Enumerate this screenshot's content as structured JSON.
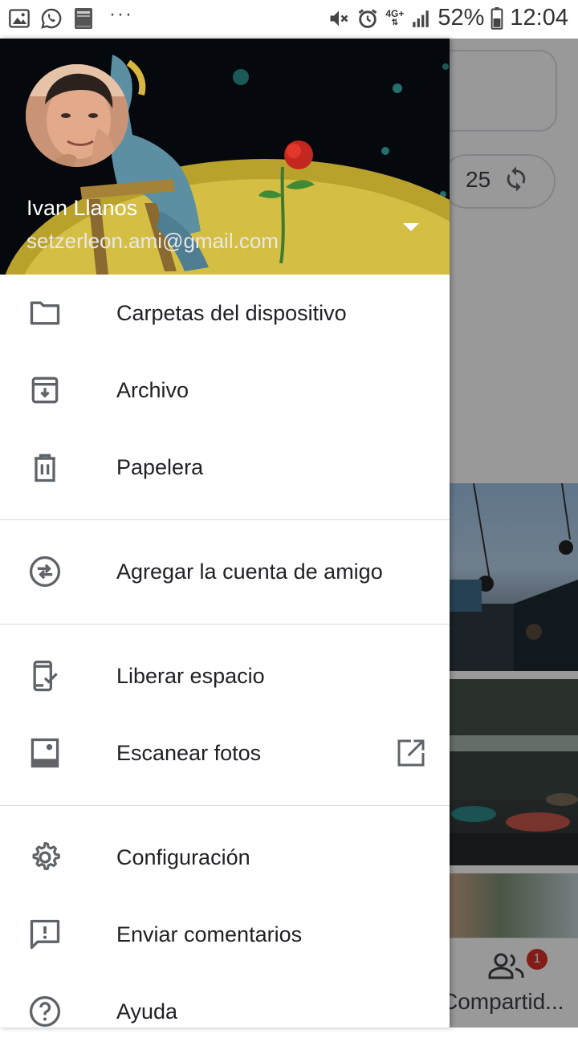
{
  "status_bar": {
    "icons_left": [
      "gallery-icon",
      "whatsapp-icon",
      "bible-icon",
      "more-notifications-icon"
    ],
    "more_label": "···",
    "network": "4G+",
    "battery": "52%",
    "time": "12:04"
  },
  "account": {
    "name": "Ivan Llanos",
    "email": "setzerleon.ami@gmail.com"
  },
  "menu": {
    "device_folders": "Carpetas del dispositivo",
    "archive": "Archivo",
    "trash": "Papelera",
    "add_partner": "Agregar la cuenta de amigo",
    "free_up_space": "Liberar espacio",
    "scan_photos": "Escanear fotos",
    "settings": "Configuración",
    "send_feedback": "Enviar comentarios",
    "help": "Ayuda"
  },
  "background": {
    "pill_count": "25",
    "sharing_label": "Compartid...",
    "sharing_badge": "1"
  },
  "colors": {
    "icon": "#5f6368",
    "text": "#202124",
    "divider": "#dadce0",
    "badge": "#d93025"
  }
}
